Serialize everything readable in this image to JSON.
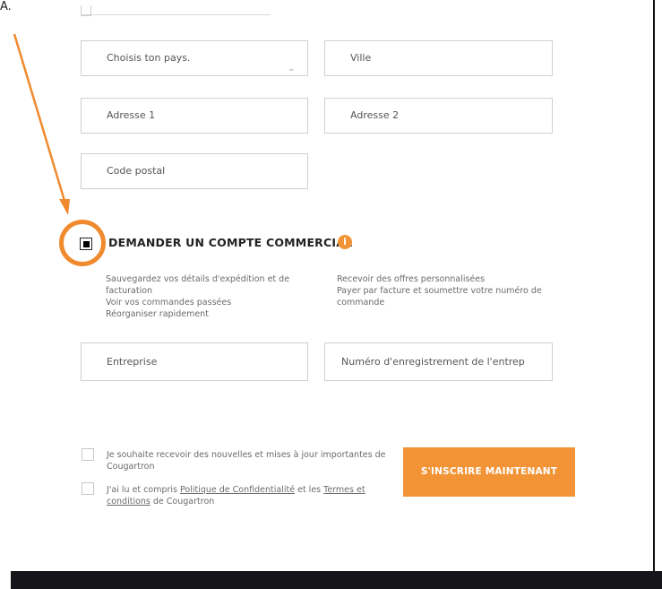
{
  "annotation": {
    "corner_label": "A."
  },
  "form": {
    "country_placeholder": "Choisis ton pays.",
    "city_placeholder": "Ville",
    "address1_placeholder": "Adresse 1",
    "address2_placeholder": "Adresse 2",
    "postal_placeholder": "Code postal",
    "company_placeholder": "Entreprise",
    "registration_placeholder": "Numéro d'enregistrement de l'entrep"
  },
  "commercial": {
    "title": "DEMANDER UN COMPTE COMMERCIAL",
    "info_icon": "i",
    "benefits_left_1": "Sauvegardez vos détails d'expédition et de",
    "benefits_left_2": "facturation",
    "benefits_left_3": "Voir vos commandes passées",
    "benefits_left_4": "Réorganiser rapidement",
    "benefits_right_1": "Recevoir des offres personnalisées",
    "benefits_right_2": "Payer par facture et soumettre votre numéro de",
    "benefits_right_3": "commande"
  },
  "consent": {
    "newsletter_1": "Je souhaite recevoir des nouvelles et mises à jour importantes de",
    "newsletter_2": "Cougartron",
    "privacy_prefix": "J'ai lu et compris",
    "privacy_link": "Politique de Confidentialité",
    "privacy_mid": "et les",
    "terms_link_1": "Termes et",
    "terms_link_2": "conditions",
    "privacy_suffix": "de Cougartron"
  },
  "cta": {
    "label": "S'INSCRIRE MAINTENANT"
  },
  "colors": {
    "accent": "#f29436",
    "footer": "#15151a",
    "annotation": "#f08a2e"
  }
}
